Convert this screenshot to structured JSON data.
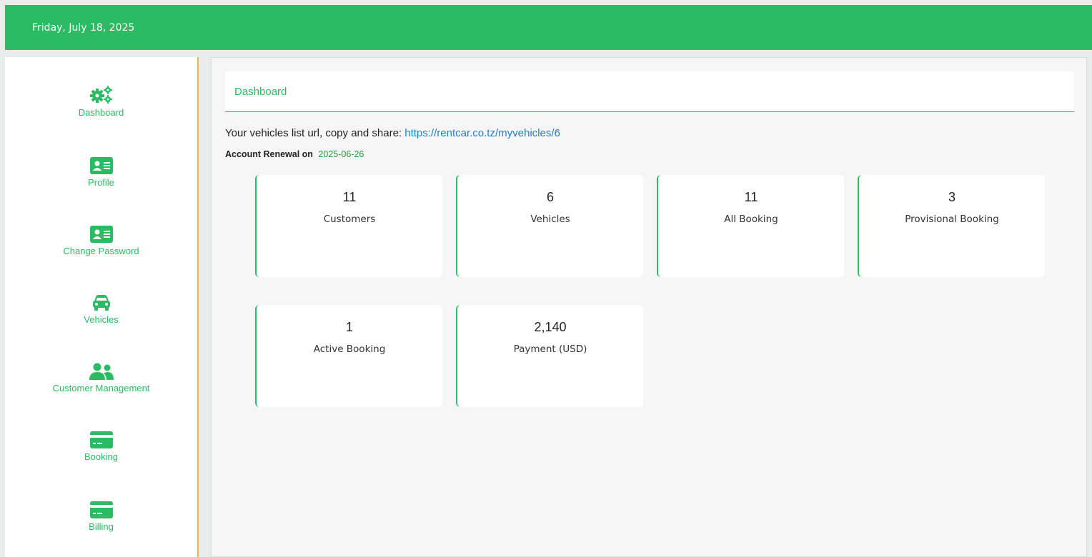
{
  "header": {
    "date": "Friday, July 18, 2025",
    "color": "#2abb63"
  },
  "sidebar": {
    "items": [
      {
        "label": "Dashboard",
        "icon": "cogs-icon"
      },
      {
        "label": "Profile",
        "icon": "id-card-icon"
      },
      {
        "label": "Change Password",
        "icon": "id-card-icon"
      },
      {
        "label": "Vehicles",
        "icon": "car-icon"
      },
      {
        "label": "Customer Management",
        "icon": "users-icon"
      },
      {
        "label": "Booking",
        "icon": "credit-card-icon"
      },
      {
        "label": "Billing",
        "icon": "credit-card-icon"
      }
    ]
  },
  "main": {
    "title": "Dashboard",
    "url_prefix": "Your vehicles list url, copy and share:",
    "url": "https://rentcar.co.tz/myvehicles/6",
    "renewal_label": "Account Renewal on",
    "renewal_date": "2025-06-26",
    "cards": [
      {
        "value": "11",
        "label": "Customers"
      },
      {
        "value": "6",
        "label": "Vehicles"
      },
      {
        "value": "11",
        "label": "All Booking"
      },
      {
        "value": "3",
        "label": "Provisional Booking"
      },
      {
        "value": "1",
        "label": "Active Booking"
      },
      {
        "value": "2,140",
        "label": "Payment (USD)"
      }
    ]
  }
}
